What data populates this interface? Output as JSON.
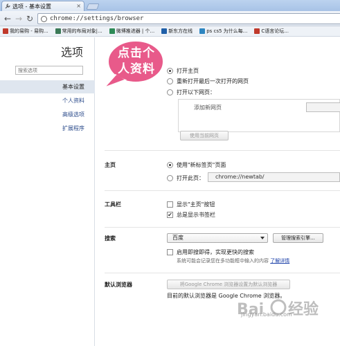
{
  "window": {
    "tab_title": "选项 - 基本设置",
    "tab_close": "×"
  },
  "toolbar": {
    "back": "←",
    "forward": "→",
    "reload": "↻",
    "url": "chrome://settings/browser"
  },
  "bookmarks": [
    {
      "label": "我的易购 - 易购...",
      "icon": "gift-icon",
      "color": "#c0392b"
    },
    {
      "label": "常用的布局对象|...",
      "icon": "c-icon",
      "color": "#3b7a57"
    },
    {
      "label": "微博推进器 | 个...",
      "icon": "leaf-icon",
      "color": "#2e8b57"
    },
    {
      "label": "新东方在线",
      "icon": "book-icon",
      "color": "#1f5fa8"
    },
    {
      "label": "ps cs5 为什么每...",
      "icon": "square-icon",
      "color": "#2e86c1"
    },
    {
      "label": "C语言论坛...",
      "icon": "c-icon",
      "color": "#c0392b"
    }
  ],
  "nav": {
    "title": "选项",
    "search_placeholder": "搜索选项",
    "items": [
      {
        "label": "基本设置",
        "active": true
      },
      {
        "label": "个人资料",
        "active": false
      },
      {
        "label": "高级选项",
        "active": false
      },
      {
        "label": "扩展程序",
        "active": false
      }
    ]
  },
  "callout": {
    "line1": "点击个",
    "line2": "人资料",
    "color": "#e85a8a"
  },
  "startup": {
    "options": [
      {
        "label": "打开主页",
        "checked": true
      },
      {
        "label": "重新打开最后一次打开的网页",
        "checked": false
      },
      {
        "label": "打开以下网页：",
        "checked": false
      }
    ],
    "add_page_label": "添加新网页",
    "use_current_button": "使用当前网页"
  },
  "homepage": {
    "section_label": "主页",
    "options": [
      {
        "label": "使用\"新标签页\"页面",
        "checked": true
      },
      {
        "label": "打开此页：",
        "checked": false
      }
    ],
    "url_value": "chrome://newtab/"
  },
  "toolbar_section": {
    "section_label": "工具栏",
    "options": [
      {
        "label": "显示\"主页\"按钮",
        "checked": false
      },
      {
        "label": "总是显示书签栏",
        "checked": true
      }
    ]
  },
  "search": {
    "section_label": "搜索",
    "engine": "百度",
    "manage_button": "管理搜索引擎...",
    "instant_label": "启用即搜即得，实现更快的搜索",
    "hint": "系统可能会记录您在多功能框中输入的内容",
    "learn_more": "了解详情"
  },
  "default_browser": {
    "section_label": "默认浏览器",
    "button": "将Google Chrome 浏览器设置为默认浏览器",
    "status": "目前的默认浏览器是 Google Chrome 浏览器。"
  },
  "watermark": {
    "text": "jingyan.baidu.com"
  }
}
